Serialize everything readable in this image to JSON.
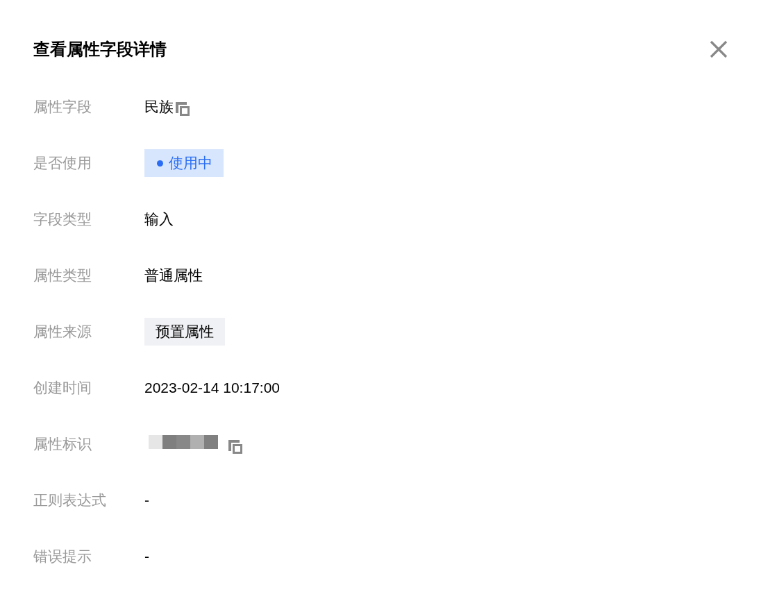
{
  "dialog": {
    "title": "查看属性字段详情"
  },
  "fields": [
    {
      "label": "属性字段",
      "kind": "text",
      "value": "民族",
      "copyable": true
    },
    {
      "label": "是否使用",
      "kind": "status",
      "value": "使用中",
      "active": true
    },
    {
      "label": "字段类型",
      "kind": "text",
      "value": "输入"
    },
    {
      "label": "属性类型",
      "kind": "text",
      "value": "普通属性"
    },
    {
      "label": "属性来源",
      "kind": "tag",
      "value": "预置属性"
    },
    {
      "label": "创建时间",
      "kind": "text",
      "value": "2023-02-14 10:17:00"
    },
    {
      "label": "属性标识",
      "kind": "redacted",
      "copyable": true
    },
    {
      "label": "正则表达式",
      "kind": "text",
      "value": "-"
    },
    {
      "label": "错误提示",
      "kind": "text",
      "value": "-"
    }
  ]
}
